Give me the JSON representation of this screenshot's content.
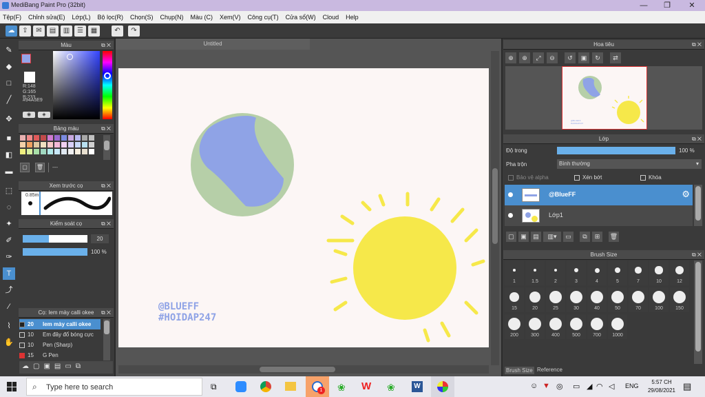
{
  "window": {
    "title": "MediBang Paint Pro (32bit)",
    "minimize": "—",
    "maximize": "❐",
    "close": "✕"
  },
  "menu": [
    "Tệp(F)",
    "Chỉnh sửa(E)",
    "Lớp(L)",
    "Bộ lọc(R)",
    "Chọn(S)",
    "Chụp(N)",
    "Màu (C)",
    "Xem(V)",
    "Công cụ(T)",
    "Cửa sổ(W)",
    "Cloud",
    "Help"
  ],
  "toolbar": {
    "undo": "↶",
    "redo": "↷"
  },
  "document": {
    "tab": "Untitled"
  },
  "color_panel": {
    "title": "Màu",
    "r": "R:148",
    "g": "G:165",
    "b": "B:233",
    "hex": "#94A5E9",
    "primary": "#94a5e9",
    "secondary": "#ffffff"
  },
  "palette_panel": {
    "title": "Bảng màu",
    "name": "---"
  },
  "brush_preview": {
    "title": "Xem trước cọ",
    "size": "0.85m"
  },
  "brush_control": {
    "title": "Kiểm soát cọ",
    "size_value": "20",
    "opacity_value": "100 %"
  },
  "brush_list": {
    "title": "Cọ: Iem mày calli okee",
    "items": [
      {
        "size": "20",
        "name": "Iem mày calli okee",
        "color": "#4a8fcf"
      },
      {
        "size": "10",
        "name": "Em đây đổ bóng cực",
        "color": "#3c3c3c"
      },
      {
        "size": "10",
        "name": "Pen (Sharp)",
        "color": "#3c3c3c"
      },
      {
        "size": "15",
        "name": "G Pen",
        "color": "#d33"
      }
    ]
  },
  "canvas": {
    "text1": "@BLUEFF",
    "text2": "#HOIDAP247"
  },
  "navigator": {
    "title": "Hoa tiêu",
    "text1": "@BLUEFF",
    "text2": "#HOIDAP247"
  },
  "layers": {
    "title": "Lớp",
    "opacity_label": "Độ trong",
    "opacity_value": "100 %",
    "opacity_fraction": 1.0,
    "blend_label": "Pha trộn",
    "blend_value": "Bình thường",
    "protect_alpha": "Bảo vệ alpha",
    "clipping": "Xén bớt",
    "lock": "Khóa",
    "items": [
      {
        "name": "@BlueFF",
        "selected": true
      },
      {
        "name": "Lớp1",
        "selected": false
      }
    ]
  },
  "brush_size": {
    "title": "Brush Size",
    "sizes": [
      "1",
      "1.5",
      "2",
      "3",
      "4",
      "5",
      "7",
      "10",
      "12",
      "15",
      "20",
      "25",
      "30",
      "40",
      "50",
      "70",
      "100",
      "150",
      "200",
      "300",
      "400",
      "500",
      "700",
      "1000"
    ],
    "tab1": "Brush Size",
    "tab2": "Reference"
  },
  "taskbar": {
    "search_placeholder": "Type here to search",
    "time": "5:57 CH",
    "date": "29/08/2021",
    "lang": "ENG",
    "badge": "1"
  },
  "colors": {
    "sun": "#f6e84a",
    "earth_green": "#b6cfa8",
    "earth_blue": "#8fa3e6",
    "accent": "#4a8fcf",
    "text_blue": "#8fa3e6"
  }
}
